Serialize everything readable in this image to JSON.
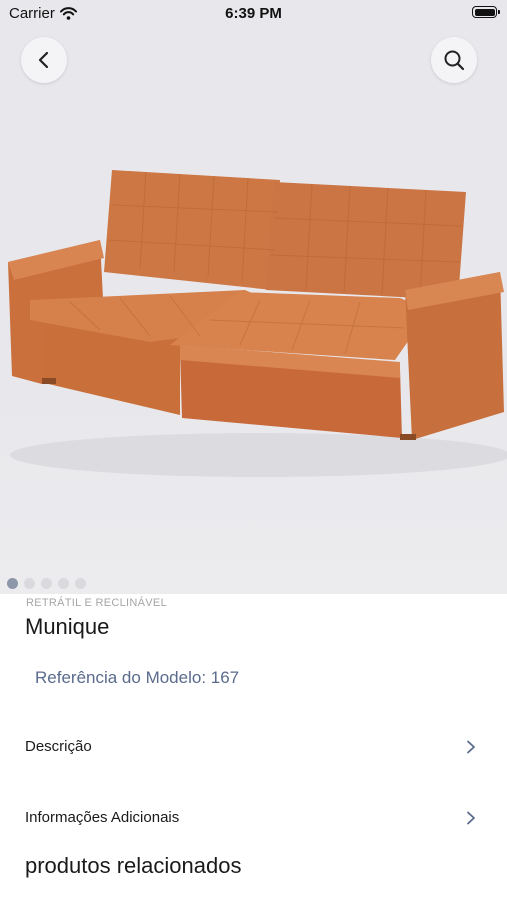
{
  "status_bar": {
    "carrier": "Carrier",
    "time": "6:39 PM"
  },
  "gallery": {
    "page_count": 5,
    "current_page": 1
  },
  "product": {
    "category": "RETRÁTIL E RECLINÁVEL",
    "name": "Munique",
    "reference": "Referência do Modelo: 167"
  },
  "sections": [
    {
      "label": "Descrição",
      "icon": "chevron-right-icon"
    },
    {
      "label": "Informações Adicionais",
      "icon": "chevron-right-icon"
    }
  ],
  "related_title": "produtos relacionados",
  "colors": {
    "sofa": "#cf7a47",
    "background": "#e8e8ec",
    "link": "#5a6b8c",
    "chevron": "#5a6b8c"
  },
  "icons": [
    "wifi-icon",
    "battery-icon",
    "back-icon",
    "search-icon",
    "chevron-right-icon"
  ]
}
